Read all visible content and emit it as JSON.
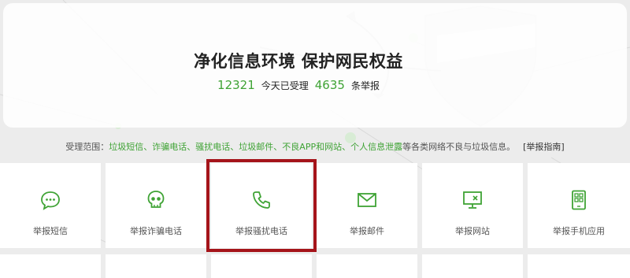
{
  "banner": {
    "title": "净化信息环境 保护网民权益",
    "stats": {
      "count_today": "12321",
      "today_label": "今天已受理",
      "total": "4635",
      "total_label": "条举报"
    }
  },
  "scope": {
    "prefix": "受理范围：",
    "items": "垃圾短信、诈骗电话、骚扰电话、垃圾邮件、不良APP和网站、个人信息泄露",
    "suffix": "等各类网络不良与垃圾信息。",
    "guide_link": "[举报指南]"
  },
  "tiles": [
    {
      "label": "举报短信",
      "icon": "message-bubble-icon"
    },
    {
      "label": "举报诈骗电话",
      "icon": "skull-icon"
    },
    {
      "label": "举报骚扰电话",
      "icon": "phone-icon"
    },
    {
      "label": "举报邮件",
      "icon": "envelope-icon"
    },
    {
      "label": "举报网站",
      "icon": "monitor-icon"
    },
    {
      "label": "举报手机应用",
      "icon": "phone-apps-icon"
    }
  ],
  "colors": {
    "accent": "#3fa335",
    "highlight": "#a5141a"
  }
}
